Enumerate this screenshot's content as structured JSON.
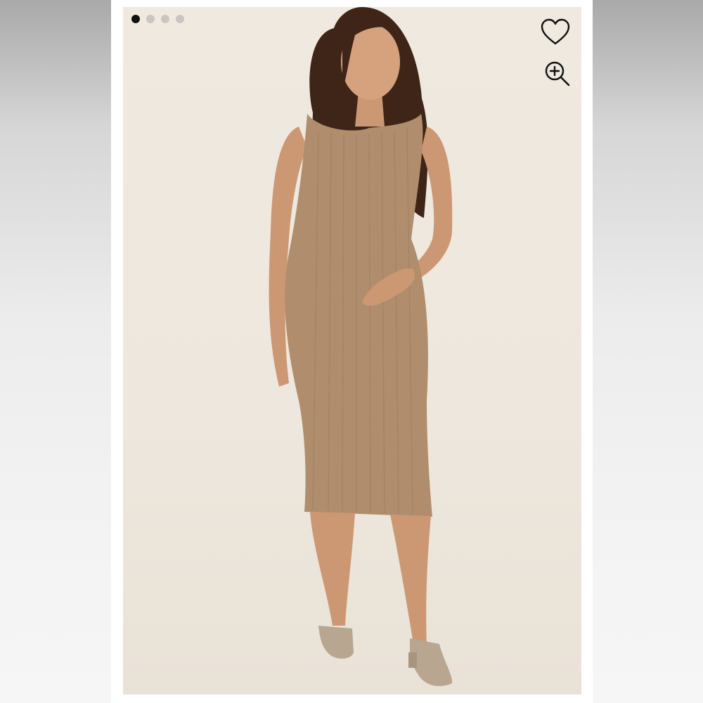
{
  "gallery": {
    "slide_count": 4,
    "active_index": 0,
    "image_alt": "",
    "colors": {
      "background": "#efe9e0",
      "dress": "#b08e6d",
      "skin": "#d09c78",
      "hair": "#3e2518",
      "active_dot": "#111111",
      "inactive_dot": "#c9c6c2"
    }
  },
  "actions": {
    "favorite_icon": "heart-outline-icon",
    "zoom_icon": "zoom-in-icon"
  }
}
